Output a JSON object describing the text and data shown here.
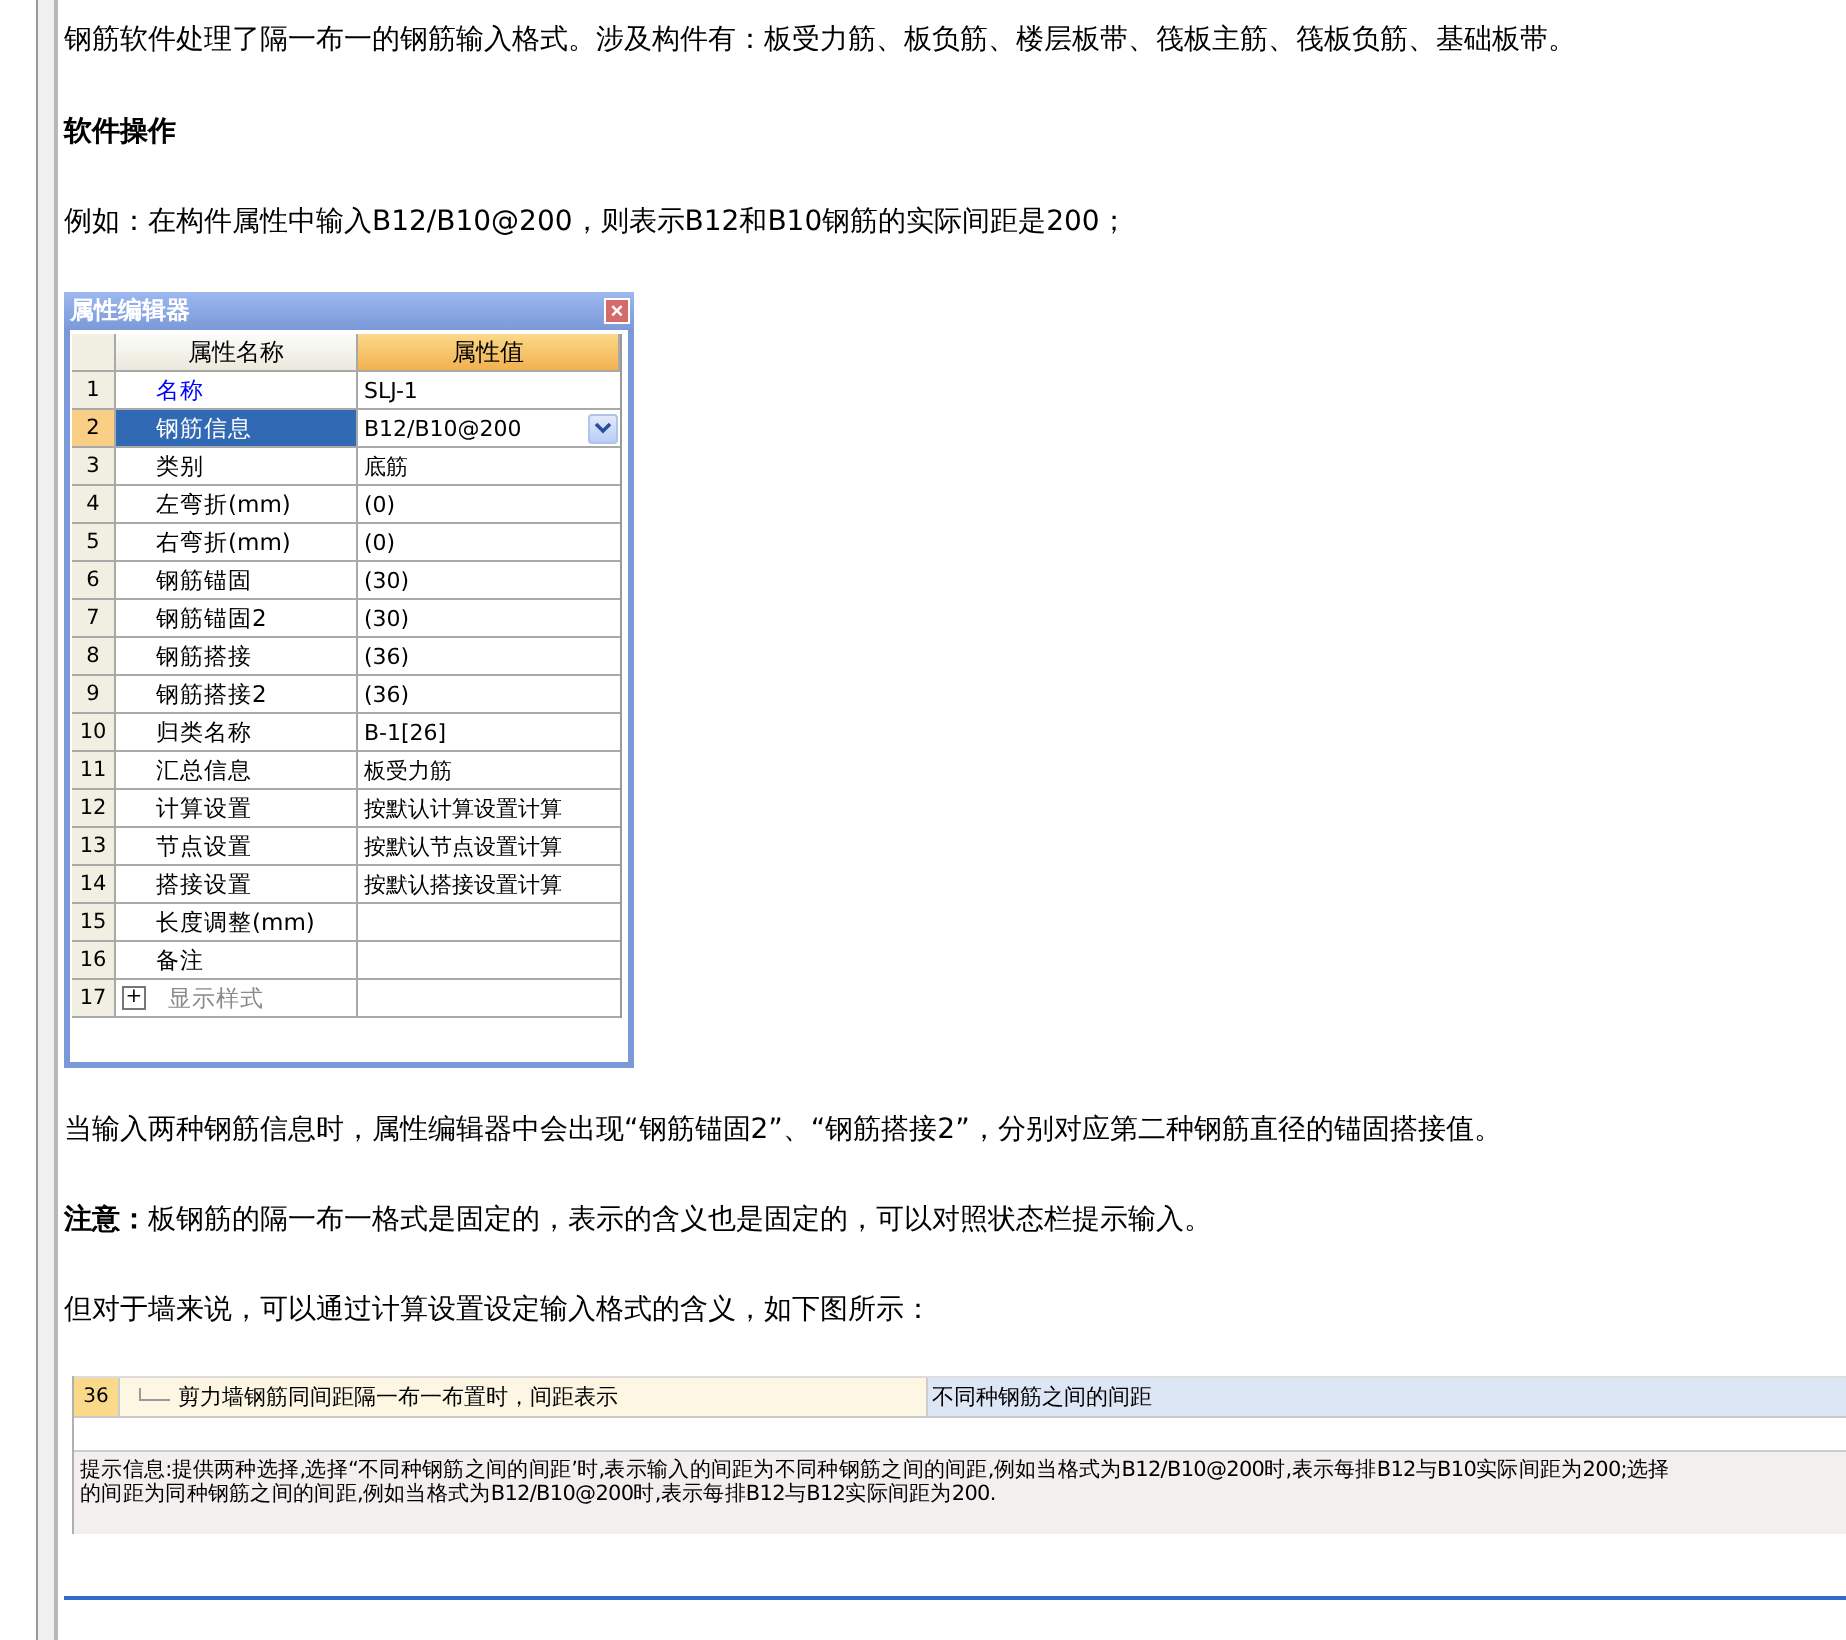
{
  "intro": "钢筋软件处理了隔一布一的钢筋输入格式。涉及构件有：板受力筋、板负筋、楼层板带、筏板主筋、筏板负筋、基础板带。",
  "heading": "软件操作",
  "example": "例如：在构件属性中输入B12/B10@200，则表示B12和B10钢筋的实际间距是200；",
  "editor": {
    "title": "属性编辑器",
    "close": "×",
    "columns": [
      "属性名称",
      "属性值"
    ],
    "rows": [
      {
        "num": "1",
        "name": "名称",
        "value": "SLJ-1",
        "kind": "link",
        "selected": false
      },
      {
        "num": "2",
        "name": "钢筋信息",
        "value": "B12/B10@200",
        "kind": "plain",
        "selected": true
      },
      {
        "num": "3",
        "name": "类别",
        "value": "底筋",
        "kind": "plain",
        "selected": false
      },
      {
        "num": "4",
        "name": "左弯折(mm)",
        "value": "(0)",
        "kind": "plain",
        "selected": false
      },
      {
        "num": "5",
        "name": "右弯折(mm)",
        "value": "(0)",
        "kind": "plain",
        "selected": false
      },
      {
        "num": "6",
        "name": "钢筋锚固",
        "value": "(30)",
        "kind": "plain",
        "selected": false
      },
      {
        "num": "7",
        "name": "钢筋锚固2",
        "value": "(30)",
        "kind": "plain",
        "selected": false
      },
      {
        "num": "8",
        "name": "钢筋搭接",
        "value": "(36)",
        "kind": "plain",
        "selected": false
      },
      {
        "num": "9",
        "name": "钢筋搭接2",
        "value": "(36)",
        "kind": "plain",
        "selected": false
      },
      {
        "num": "10",
        "name": "归类名称",
        "value": "B-1[26]",
        "kind": "plain",
        "selected": false
      },
      {
        "num": "11",
        "name": "汇总信息",
        "value": "板受力筋",
        "kind": "plain",
        "selected": false
      },
      {
        "num": "12",
        "name": "计算设置",
        "value": "按默认计算设置计算",
        "kind": "plain",
        "selected": false
      },
      {
        "num": "13",
        "name": "节点设置",
        "value": "按默认节点设置计算",
        "kind": "plain",
        "selected": false
      },
      {
        "num": "14",
        "name": "搭接设置",
        "value": "按默认搭接设置计算",
        "kind": "plain",
        "selected": false
      },
      {
        "num": "15",
        "name": "长度调整(mm)",
        "kind": "plain",
        "selected": false
      },
      {
        "num": "16",
        "name": "备注",
        "kind": "plain",
        "selected": false
      },
      {
        "num": "17",
        "name": "显示样式",
        "kind": "group",
        "expander": "+",
        "selected": false
      }
    ]
  },
  "note1": "当输入两种钢筋信息时，属性编辑器中会出现“钢筋锚固2”、“钢筋搭接2”，分别对应第二种钢筋直径的锚固搭接值。",
  "note2": "**注意：**板钢筋的隔一布一格式是固定的，表示的含义也是固定的，可以对照状态栏提示输入。",
  "note3": "但对于墙来说，可以通过计算设置设定输入格式的含义，如下图所示：",
  "settings": {
    "row": {
      "num": "36",
      "name": "剪力墙钢筋同间距隔一布一布置时，间距表示",
      "value": "不同种钢筋之间的间距"
    },
    "hint": [
      "提示信息:提供两种选择,选择“不同种钢筋之间的间距’时,表示输入的间距为不同种钢筋之间的间距,例如当格式为B12/B10@200时,表示每排B12与B10实际间距为200;选择",
      "的间距为同种钢筋之间的间距,例如当格式为B12/B10@200时,表示每排B12与B12实际间距为200."
    ]
  }
}
